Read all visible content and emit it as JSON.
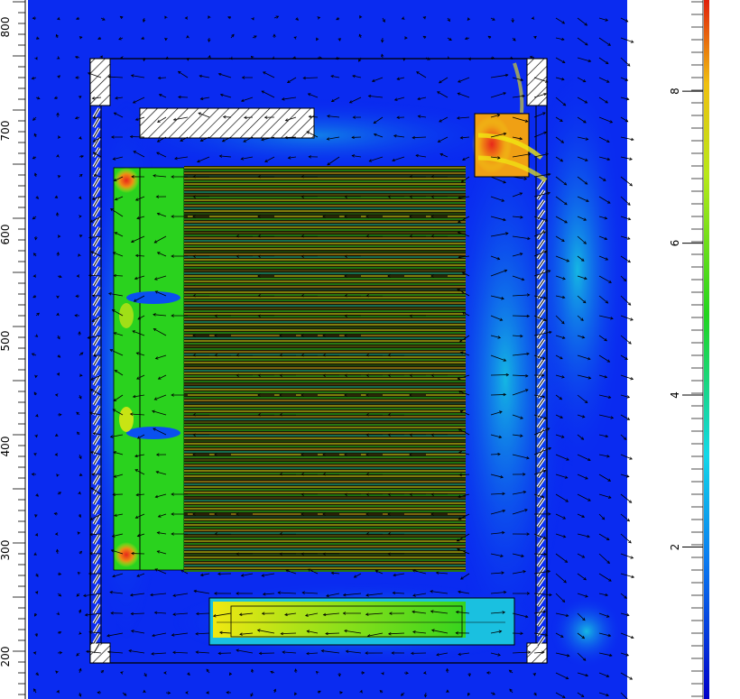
{
  "colors": {
    "background_field": "#0a2bf0",
    "low": "#0a2bf0",
    "mid_low": "#12c8f0",
    "mid": "#22d41e",
    "mid_high": "#f0e812",
    "high": "#e8281a",
    "wall_fill": "#ffffff",
    "outline": "#000000"
  },
  "colorbar": {
    "labels": [
      {
        "value": 2,
        "text": "2"
      },
      {
        "value": 4,
        "text": "4"
      },
      {
        "value": 6,
        "text": "6"
      },
      {
        "value": 8,
        "text": "8"
      }
    ],
    "range": [
      0,
      9.2
    ],
    "orientation": "vertical"
  },
  "left_ruler": {
    "labels": [
      "200",
      "300",
      "400",
      "500",
      "600",
      "700",
      "800"
    ]
  }
}
